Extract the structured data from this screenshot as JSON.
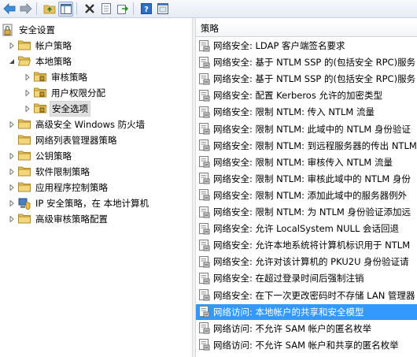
{
  "toolbar": {
    "buttons": [
      "back-arrow-icon",
      "forward-arrow-icon",
      "up-folder-icon",
      "show-tree-icon",
      "delete-icon",
      "properties-icon",
      "export-icon",
      "help-icon",
      "console-icon"
    ]
  },
  "tree": {
    "root": "安全设置",
    "account_policies": "帐户策略",
    "local_policies": "本地策略",
    "audit_policy": "审核策略",
    "user_rights": "用户权限分配",
    "security_options": "安全选项",
    "firewall": "高级安全 Windows 防火墙",
    "network_list": "网络列表管理器策略",
    "public_key": "公钥策略",
    "software_restriction": "软件限制策略",
    "app_control": "应用程序控制策略",
    "ipsec": "IP 安全策略，在 本地计算机",
    "advanced_audit": "高级审核策略配置"
  },
  "list": {
    "header": "策略",
    "items": [
      "网络安全: LDAP 客户端签名要求",
      "网络安全: 基于 NTLM SSP 的(包括安全 RPC)服务",
      "网络安全: 基于 NTLM SSP 的(包括安全 RPC)服务",
      "网络安全: 配置 Kerberos 允许的加密类型",
      "网络安全: 限制 NTLM: 传入 NTLM 流量",
      "网络安全: 限制 NTLM: 此域中的 NTLM 身份验证",
      "网络安全: 限制 NTLM: 到远程服务器的传出 NTLM",
      "网络安全: 限制 NTLM: 审核传入 NTLM 流量",
      "网络安全: 限制 NTLM: 审核此域中的 NTLM 身份",
      "网络安全: 限制 NTLM: 添加此域中的服务器例外",
      "网络安全: 限制 NTLM: 为 NTLM 身份验证添加远",
      "网络安全: 允许 LocalSystem NULL 会话回退",
      "网络安全: 允许本地系统将计算机标识用于 NTLM",
      "网络安全: 允许对该计算机的 PKU2U 身份验证请",
      "网络安全: 在超过登录时间后强制注销",
      "网络安全: 在下一次更改密码时不存储 LAN 管理器",
      "网络访问: 本地帐户的共享和安全模型",
      "网络访问: 不允许 SAM 帐户的匿名枚举",
      "网络访问: 不允许 SAM 帐户和共享的匿名枚举"
    ],
    "selected_index": 16
  },
  "colors": {
    "selection": "#3399ff",
    "folder": "#e8c15a"
  }
}
